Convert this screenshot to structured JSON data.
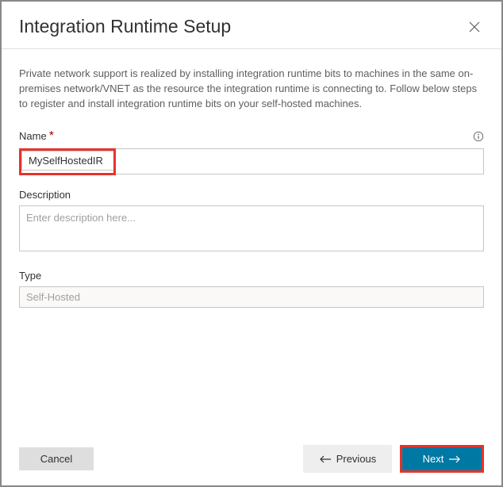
{
  "header": {
    "title": "Integration Runtime Setup"
  },
  "intro": "Private network support is realized by installing integration runtime bits to machines in the same on-premises network/VNET as the resource the integration runtime is connecting to. Follow below steps to register and install integration runtime bits on your self-hosted machines.",
  "fields": {
    "name": {
      "label": "Name",
      "value": "MySelfHostedIR"
    },
    "description": {
      "label": "Description",
      "placeholder": "Enter description here..."
    },
    "type": {
      "label": "Type",
      "value": "Self-Hosted"
    }
  },
  "footer": {
    "cancel": "Cancel",
    "previous": "Previous",
    "next": "Next"
  }
}
